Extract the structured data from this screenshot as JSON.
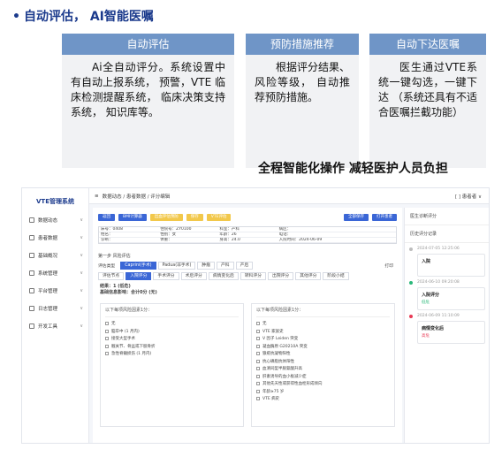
{
  "heading": {
    "bullet": "•",
    "text": "自动评估， AI智能医嘱"
  },
  "features": [
    {
      "title": "自动评估",
      "body": "Ai全自动评分。系统设置中有自动上报系统， 预警，VTE 临床检测提醒系统， 临床决策支持系统， 知识库等。"
    },
    {
      "title": "预防措施推荐",
      "body": "根据评分结果、风险等级， 自动推荐预防措施。"
    },
    {
      "title": "自动下达医嘱",
      "body": "医生通过VTE系统一键勾选，一键下达 （系统还具有不适合医嘱拦截功能）"
    }
  ],
  "slogan": "全程智能化操作  减轻医护人员负担",
  "app": {
    "logo": "VTE管理系统",
    "sidebar": [
      "数据动态",
      "患者数据",
      "基础概况",
      "系统管理",
      "平台管理",
      "日志管理",
      "开发工具"
    ],
    "breadcrumb": "数据动态 / 患者数据 / 评分编辑",
    "user": "[ ] 患者者 ∨",
    "buttons": [
      {
        "label": "返回",
        "color": "#3a66d6"
      },
      {
        "label": "BMI计算器",
        "color": "#3a66d6"
      },
      {
        "label": "出血评估预防",
        "color": "#f2c84b"
      },
      {
        "label": "保存",
        "color": "#f2c84b"
      },
      {
        "label": "VTE评估",
        "color": "#f2c84b"
      },
      {
        "label": "全部保存",
        "color": "#3a66d6"
      },
      {
        "label": "打开患者",
        "color": "#3a66d6"
      }
    ],
    "info_cells": [
      "床号：0408",
      "住院号：ZY0100",
      "科室：产科",
      "病区：",
      "",
      "姓名：",
      "性别：女",
      "年龄：26",
      "电话：",
      "",
      "诊断：",
      "体重：",
      "身高：24.0",
      "入院时间：2024-06-09",
      ""
    ],
    "step_title": "第一步  风险评估",
    "model_label": "评估类型",
    "model_tabs": [
      "Caprini(手术)",
      "Padua(非手术)",
      "肿瘤",
      "产科",
      "产后"
    ],
    "print_label": "打印",
    "section_tabs": [
      "评估节点",
      "入院评分",
      "手术评分",
      "术后评分",
      "病情变化后",
      "转科评分",
      "出院评分",
      "其他评分",
      "阶段小结"
    ],
    "result_line1": "结果：1 (低危)",
    "result_line2": "基础信息影响：合计0分 (无)",
    "left_pane": {
      "header": "以下每项风险因素1分：",
      "items": [
        "无",
        "脑卒中 (1 月内)",
        "接受大型手术",
        "髋关节、骨盆或下肢骨折",
        "急性脊髓损伤 (1 月内)"
      ]
    },
    "right_pane": {
      "header": "以下每项风险因素1分：",
      "items": [
        "无",
        "VTE 家族史",
        "V 因子 Leiden 突变",
        "凝血酶原 G20210A 突变",
        "狼疮抗凝物阳性",
        "抗心磷脂抗体阳性",
        "血清同型半胱氨酸升高",
        "肝素诱导的血小板减少症",
        "其他先天性或获得性血栓形成倾向",
        "年龄≥75 岁",
        "VTE 病史"
      ]
    },
    "right_panel": {
      "header1": "医生诊断评分",
      "header2": "历史评分记录",
      "entries": [
        {
          "date": "2024-07-05 12:25:06",
          "title": "入院",
          "sub": "",
          "dot": "#bdbdbd"
        },
        {
          "date": "2024-06-10 09:20:08",
          "title": "入院评分",
          "sub": "低危",
          "dot": "#2ab87a",
          "sub_color": "#2ab87a"
        },
        {
          "date": "2024-06-09 11:10:09",
          "title": "病情变化后",
          "sub": "高危",
          "dot": "#e83a55",
          "sub_color": "#e83a55"
        }
      ]
    }
  }
}
